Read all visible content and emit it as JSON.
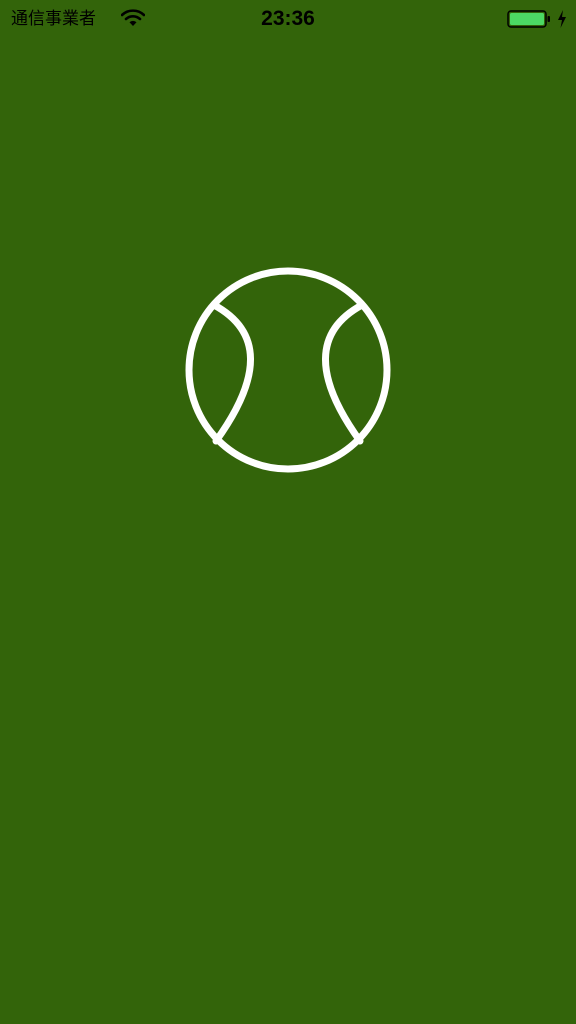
{
  "status_bar": {
    "carrier": "通信事業者",
    "time": "23:36",
    "wifi_icon": "wifi-icon",
    "battery_icon": "battery-full-icon",
    "charging_icon": "charging-bolt-icon",
    "battery_color": "#4cd964"
  },
  "splash": {
    "logo_icon": "tennis-ball-icon",
    "background_color": "#33640a",
    "logo_color": "#ffffff"
  }
}
